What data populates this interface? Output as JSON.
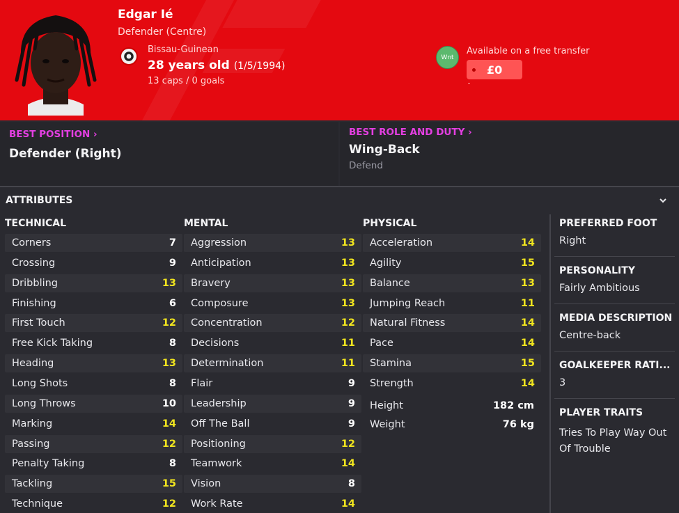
{
  "player": {
    "name": "Edgar Ié",
    "position": "Defender (Centre)",
    "nationality": "Bissau-Guinean",
    "age": "28 years old",
    "dob": "(1/5/1994)",
    "caps": "13 caps / 0 goals",
    "wnt_badge": "Wnt",
    "transfer_status": "Available on a free transfer",
    "price": "£0",
    "price_dash": "-"
  },
  "best_position": {
    "heading": "BEST POSITION",
    "value": "Defender (Right)"
  },
  "best_role": {
    "heading": "BEST ROLE AND DUTY",
    "value": "Wing-Back",
    "duty": "Defend"
  },
  "attributes": {
    "header": "ATTRIBUTES",
    "technical": {
      "title": "TECHNICAL",
      "rows": [
        {
          "label": "Corners",
          "value": "7"
        },
        {
          "label": "Crossing",
          "value": "9"
        },
        {
          "label": "Dribbling",
          "value": "13"
        },
        {
          "label": "Finishing",
          "value": "6"
        },
        {
          "label": "First Touch",
          "value": "12"
        },
        {
          "label": "Free Kick Taking",
          "value": "8"
        },
        {
          "label": "Heading",
          "value": "13"
        },
        {
          "label": "Long Shots",
          "value": "8"
        },
        {
          "label": "Long Throws",
          "value": "10"
        },
        {
          "label": "Marking",
          "value": "14"
        },
        {
          "label": "Passing",
          "value": "12"
        },
        {
          "label": "Penalty Taking",
          "value": "8"
        },
        {
          "label": "Tackling",
          "value": "15"
        },
        {
          "label": "Technique",
          "value": "12"
        }
      ]
    },
    "mental": {
      "title": "MENTAL",
      "rows": [
        {
          "label": "Aggression",
          "value": "13"
        },
        {
          "label": "Anticipation",
          "value": "13"
        },
        {
          "label": "Bravery",
          "value": "13"
        },
        {
          "label": "Composure",
          "value": "13"
        },
        {
          "label": "Concentration",
          "value": "12"
        },
        {
          "label": "Decisions",
          "value": "11"
        },
        {
          "label": "Determination",
          "value": "11"
        },
        {
          "label": "Flair",
          "value": "9"
        },
        {
          "label": "Leadership",
          "value": "9"
        },
        {
          "label": "Off The Ball",
          "value": "9"
        },
        {
          "label": "Positioning",
          "value": "12"
        },
        {
          "label": "Teamwork",
          "value": "14"
        },
        {
          "label": "Vision",
          "value": "8"
        },
        {
          "label": "Work Rate",
          "value": "14"
        }
      ]
    },
    "physical": {
      "title": "PHYSICAL",
      "rows": [
        {
          "label": "Acceleration",
          "value": "14"
        },
        {
          "label": "Agility",
          "value": "15"
        },
        {
          "label": "Balance",
          "value": "13"
        },
        {
          "label": "Jumping Reach",
          "value": "11"
        },
        {
          "label": "Natural Fitness",
          "value": "14"
        },
        {
          "label": "Pace",
          "value": "14"
        },
        {
          "label": "Stamina",
          "value": "15"
        },
        {
          "label": "Strength",
          "value": "14"
        }
      ],
      "height_label": "Height",
      "height_value": "182 cm",
      "weight_label": "Weight",
      "weight_value": "76 kg"
    }
  },
  "side": {
    "preferred_foot_title": "PREFERRED FOOT",
    "preferred_foot": "Right",
    "personality_title": "PERSONALITY",
    "personality": "Fairly Ambitious",
    "media_title": "MEDIA DESCRIPTION",
    "media": "Centre-back",
    "gk_title": "GOALKEEPER RATI...",
    "gk": "3",
    "traits_title": "PLAYER TRAITS",
    "traits_line1": "Tries To Play Way Out",
    "traits_line2": "Of Trouble"
  },
  "colors": {
    "header_red": "#e40910",
    "accent_magenta": "#e43fe2",
    "high_value_yellow": "#f1e51f",
    "wnt_green": "#5cb96e"
  }
}
